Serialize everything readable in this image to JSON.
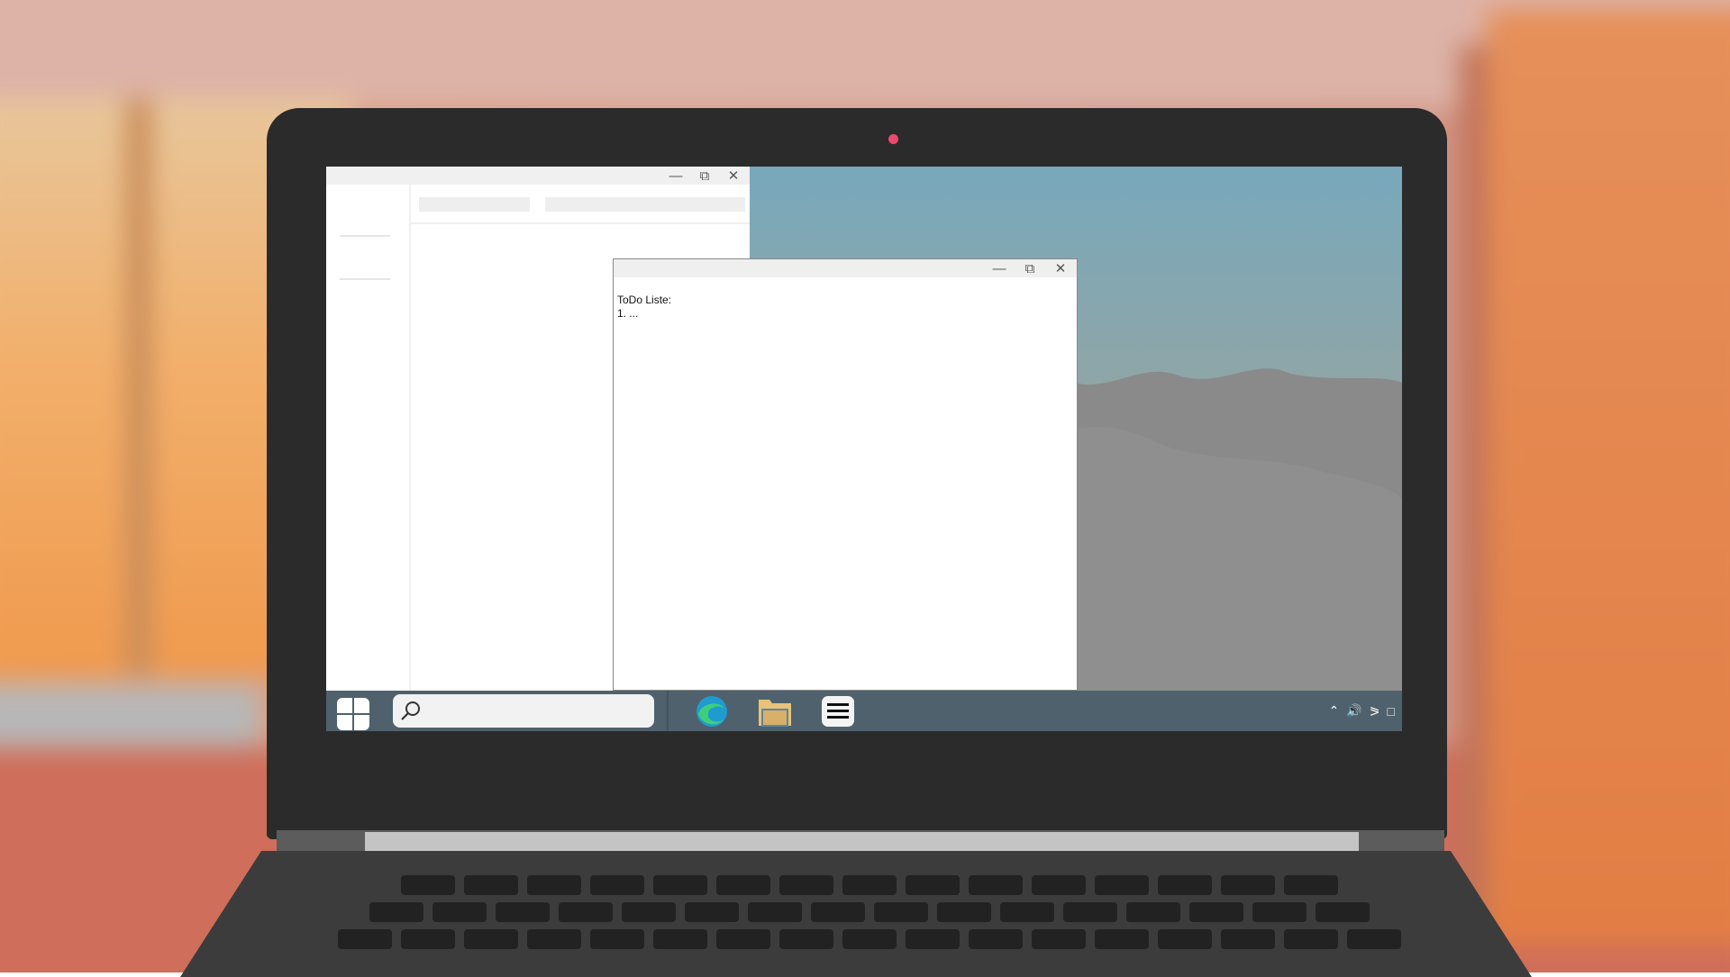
{
  "notepad": {
    "lines": [
      "ToDo Liste:",
      "1. ..."
    ]
  },
  "taskbar": {
    "search_placeholder": "",
    "apps": [
      "edge-browser",
      "file-explorer",
      "notes-app"
    ],
    "tray_icons": [
      "chevron-up-icon",
      "volume-icon",
      "network-icon",
      "notification-icon"
    ]
  },
  "colors": {
    "taskbar": "#4f616c",
    "lid": "#2b2b2b",
    "webcam": "#ea4a6e"
  }
}
